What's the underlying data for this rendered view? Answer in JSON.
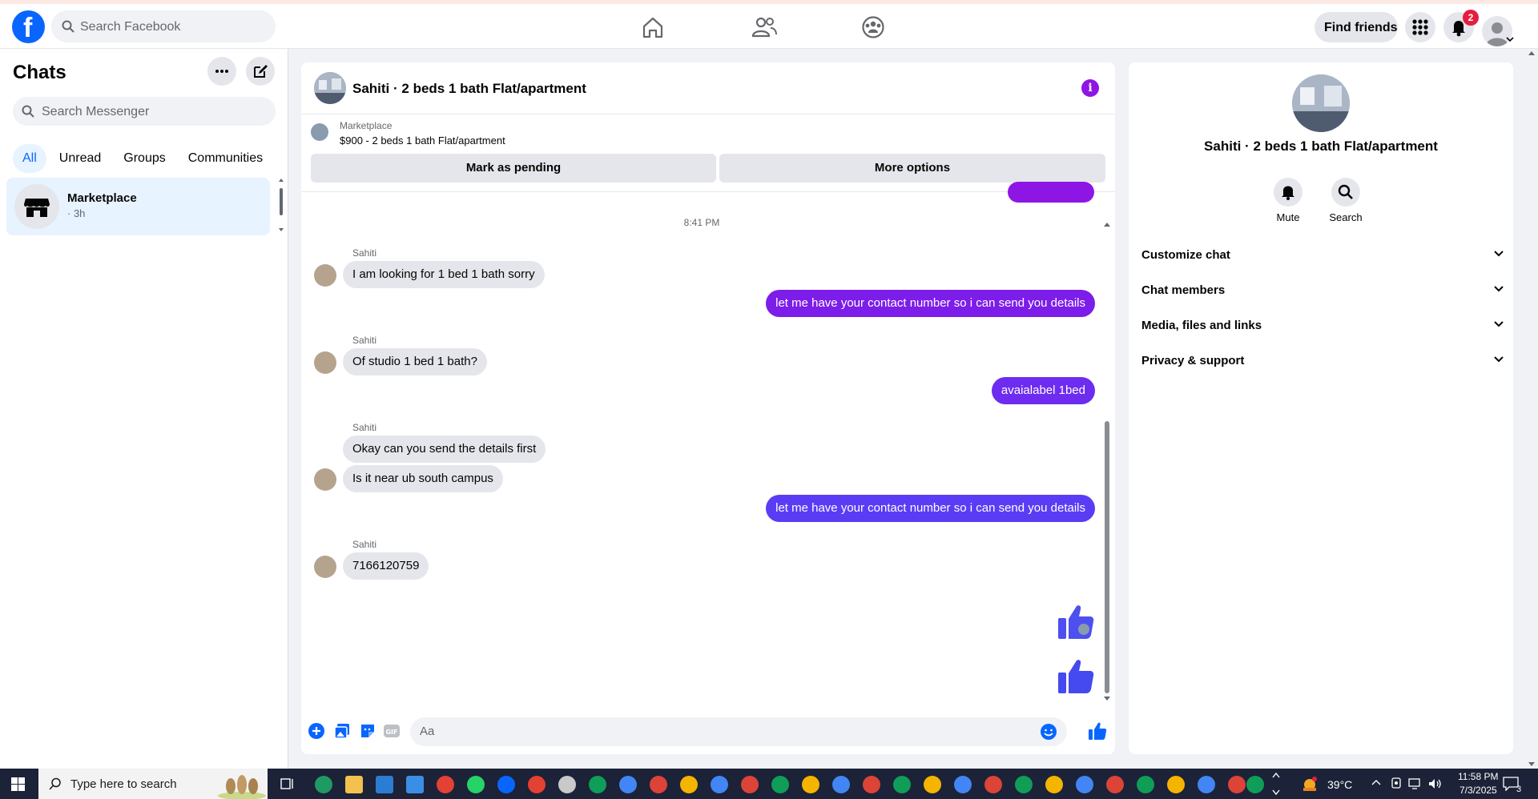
{
  "topbar": {
    "logo_letter": "f",
    "search_placeholder": "Search Facebook",
    "find_friends": "Find friends",
    "notification_count": "2"
  },
  "sidebar": {
    "title": "Chats",
    "search_placeholder": "Search Messenger",
    "filters": [
      "All",
      "Unread",
      "Groups",
      "Communities"
    ],
    "chat": {
      "name": "Marketplace",
      "time": "· 3h"
    }
  },
  "chat": {
    "title": "Sahiti · 2 beds 1 bath Flat/apartment",
    "marketplace_label": "Marketplace",
    "listing": "$900 - 2 beds 1 bath Flat/apartment",
    "mark_pending": "Mark as pending",
    "more_options": "More options",
    "timestamp": "8:41 PM",
    "messages": [
      {
        "sender": "Sahiti",
        "text": "I am looking for 1 bed 1 bath sorry"
      },
      {
        "text": "let me have your contact number so i can send you details"
      },
      {
        "sender": "Sahiti",
        "text": "Of studio 1 bed 1 bath?"
      },
      {
        "text": "avaialabel 1bed"
      },
      {
        "sender": "Sahiti",
        "text": "Okay can you send the details first"
      },
      {
        "text": "Is it near ub south campus"
      },
      {
        "text": "let me have your contact number so i can send you details"
      },
      {
        "sender": "Sahiti",
        "text": "7166120759"
      }
    ],
    "composer_placeholder": "Aa"
  },
  "info_panel": {
    "title": "Sahiti · 2 beds 1 bath Flat/apartment",
    "actions": [
      "Mute",
      "Search"
    ],
    "sections": [
      "Customize chat",
      "Chat members",
      "Media, files and links",
      "Privacy & support"
    ]
  },
  "taskbar": {
    "search_placeholder": "Type here to search",
    "weather": "39°C",
    "time": "11:58 PM",
    "date": "7/3/2025",
    "notif_count": "3"
  },
  "colors": {
    "brand_blue": "#0866ff",
    "bubble_purple": "#8e16e5",
    "bubble_indigo": "#5b3cf5",
    "incoming_gray": "#e4e6eb"
  }
}
